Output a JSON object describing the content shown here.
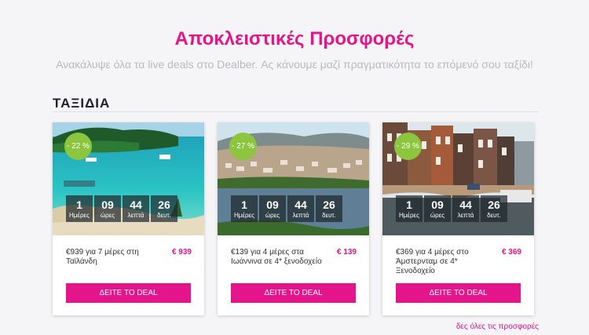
{
  "header": {
    "title": "Αποκλειστικές Προσφορές",
    "subtitle": "Ανακάλυψε όλα τα live deals στο Dealber. Ας κάνουμε μαζί πραγματικότητα το επόμενό σου ταξίδι!"
  },
  "section": {
    "title": "ΤΑΞΙΔΙΑ"
  },
  "countdown_labels": {
    "days": "Ημέρες",
    "hours": "ώρες",
    "minutes": "λεπτά",
    "seconds": "δευτ."
  },
  "cards": [
    {
      "image": "thailand-beach-photo",
      "discount": "- 22 %",
      "timer": {
        "days": "1",
        "hours": "09",
        "minutes": "44",
        "seconds": "26"
      },
      "description": "€939 για 7 μέρες στη Ταϊλάνδη",
      "price": "€ 939",
      "button": "ΔΕΙΤΕ ΤΟ DEAL"
    },
    {
      "image": "ioannina-lake-photo",
      "discount": "- 27 %",
      "timer": {
        "days": "1",
        "hours": "09",
        "minutes": "44",
        "seconds": "26"
      },
      "description": "€139 για 4 μέρες στα Ιωάννινα σε 4* ξενοδοχείο",
      "price": "€ 139",
      "button": "ΔΕΙΤΕ ΤΟ DEAL"
    },
    {
      "image": "amsterdam-canal-photo",
      "discount": "- 29 %",
      "timer": {
        "days": "1",
        "hours": "09",
        "minutes": "44",
        "seconds": "26"
      },
      "description": "€369 για 4 μέρες στο Άμστερνταμ σε 4* Ξενοδοχείο",
      "price": "€ 369",
      "button": "ΔΕΙΤΕ ΤΟ DEAL"
    }
  ],
  "footer": {
    "see_all": "δες όλες τις προσφορές"
  },
  "colors": {
    "accent": "#e4148a",
    "badge": "#8cc63f"
  }
}
